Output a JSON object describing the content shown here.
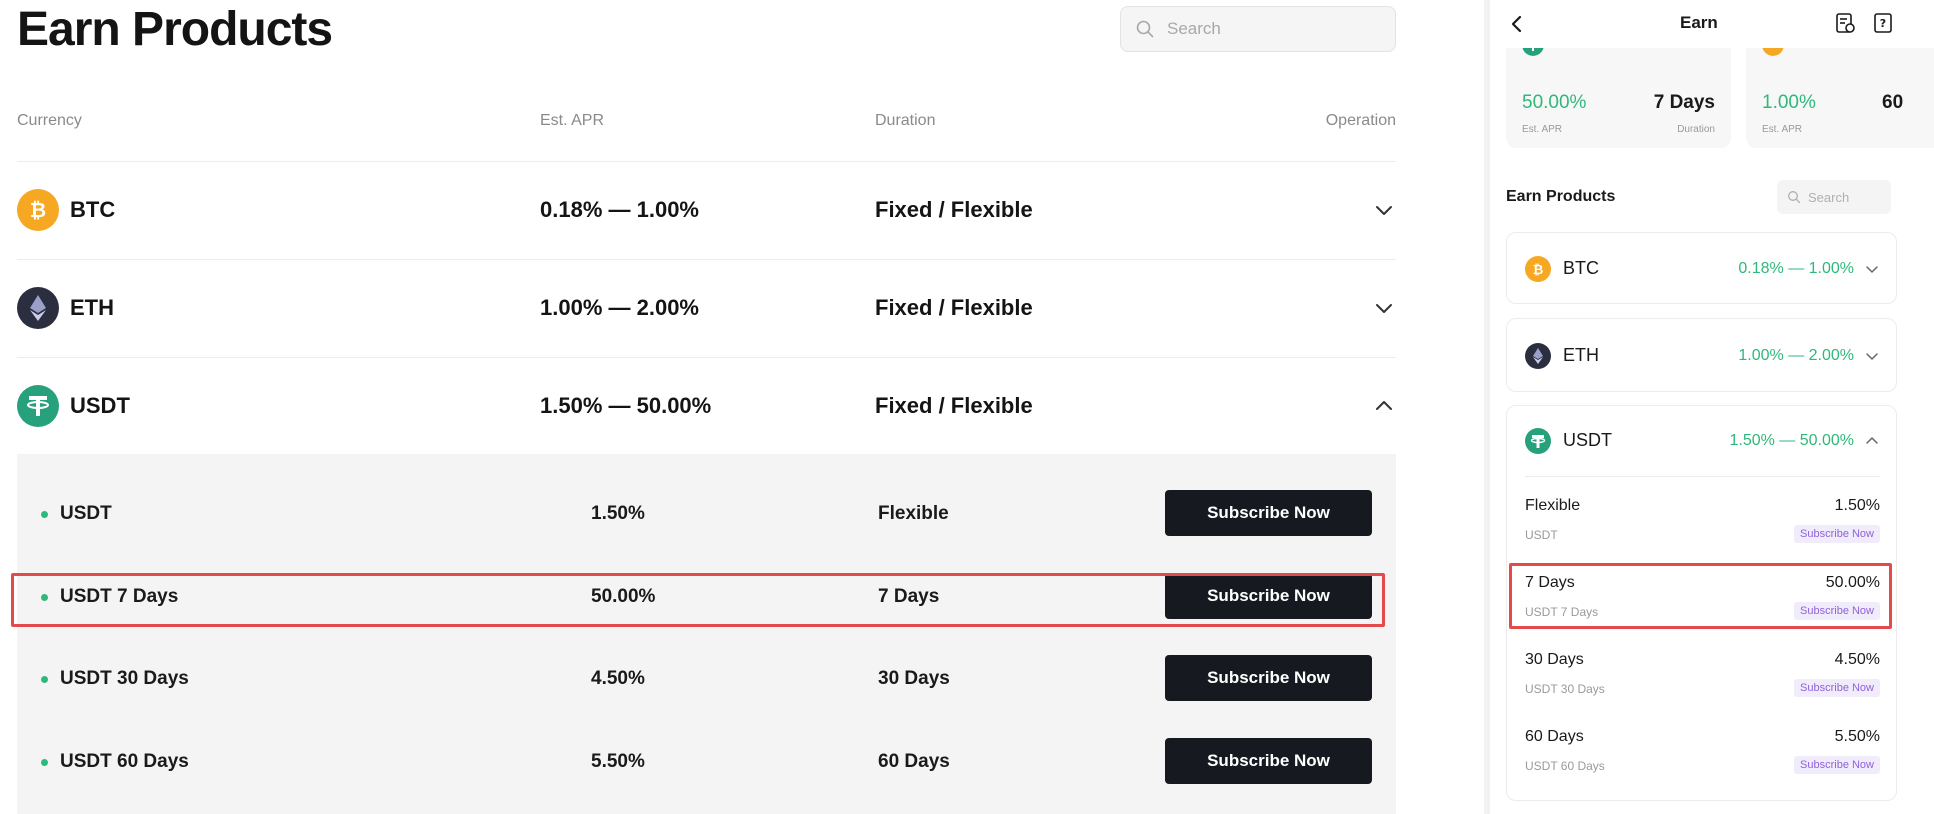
{
  "desktop": {
    "title": "Earn Products",
    "search": {
      "placeholder": "Search"
    },
    "columns": {
      "currency": "Currency",
      "apr": "Est. APR",
      "duration": "Duration",
      "operation": "Operation"
    },
    "rows": [
      {
        "symbol": "BTC",
        "apr": "0.18% — 1.00%",
        "duration": "Fixed / Flexible",
        "color": "#F7A823",
        "expanded": false
      },
      {
        "symbol": "ETH",
        "apr": "1.00% — 2.00%",
        "duration": "Fixed / Flexible",
        "color": "#2B2E3F",
        "expanded": false
      },
      {
        "symbol": "USDT",
        "apr": "1.50% — 50.00%",
        "duration": "Fixed / Flexible",
        "color": "#26A17B",
        "expanded": true
      }
    ],
    "usdt_products": [
      {
        "name": "USDT",
        "rate": "1.50%",
        "duration": "Flexible",
        "button": "Subscribe Now"
      },
      {
        "name": "USDT 7 Days",
        "rate": "50.00%",
        "duration": "7 Days",
        "button": "Subscribe Now",
        "highlighted": true
      },
      {
        "name": "USDT 30 Days",
        "rate": "4.50%",
        "duration": "30 Days",
        "button": "Subscribe Now"
      },
      {
        "name": "USDT 60 Days",
        "rate": "5.50%",
        "duration": "60 Days",
        "button": "Subscribe Now"
      }
    ]
  },
  "mobile": {
    "header": {
      "title": "Earn"
    },
    "featured": [
      {
        "coin": "USDT",
        "apr": "50.00%",
        "apr_label": "Est. APR",
        "duration": "7 Days",
        "duration_label": "Duration"
      },
      {
        "coin": "BTC",
        "apr": "1.00%",
        "apr_label": "Est. APR",
        "duration": "60"
      }
    ],
    "section_title": "Earn Products",
    "search": {
      "placeholder": "Search"
    },
    "items": [
      {
        "symbol": "BTC",
        "range": "0.18% — 1.00%"
      },
      {
        "symbol": "ETH",
        "range": "1.00% — 2.00%"
      },
      {
        "symbol": "USDT",
        "range": "1.50% — 50.00%"
      }
    ],
    "usdt_products": [
      {
        "name": "Flexible",
        "rate": "1.50%",
        "sub": "USDT",
        "button": "Subscribe Now"
      },
      {
        "name": "7 Days",
        "rate": "50.00%",
        "sub": "USDT 7 Days",
        "button": "Subscribe Now",
        "highlighted": true
      },
      {
        "name": "30 Days",
        "rate": "4.50%",
        "sub": "USDT 30 Days",
        "button": "Subscribe Now"
      },
      {
        "name": "60 Days",
        "rate": "5.50%",
        "sub": "USDT 60 Days",
        "button": "Subscribe Now"
      }
    ]
  },
  "colors": {
    "green": "#2FB87A",
    "highlight": "#E34B4B",
    "button_dark": "#161A20",
    "purple_tag": "#8F62D9"
  },
  "icons": [
    "search-icon",
    "chevron-down-icon",
    "chevron-up-icon",
    "back-arrow-icon",
    "records-icon",
    "help-icon",
    "btc-icon",
    "eth-icon",
    "usdt-icon"
  ]
}
